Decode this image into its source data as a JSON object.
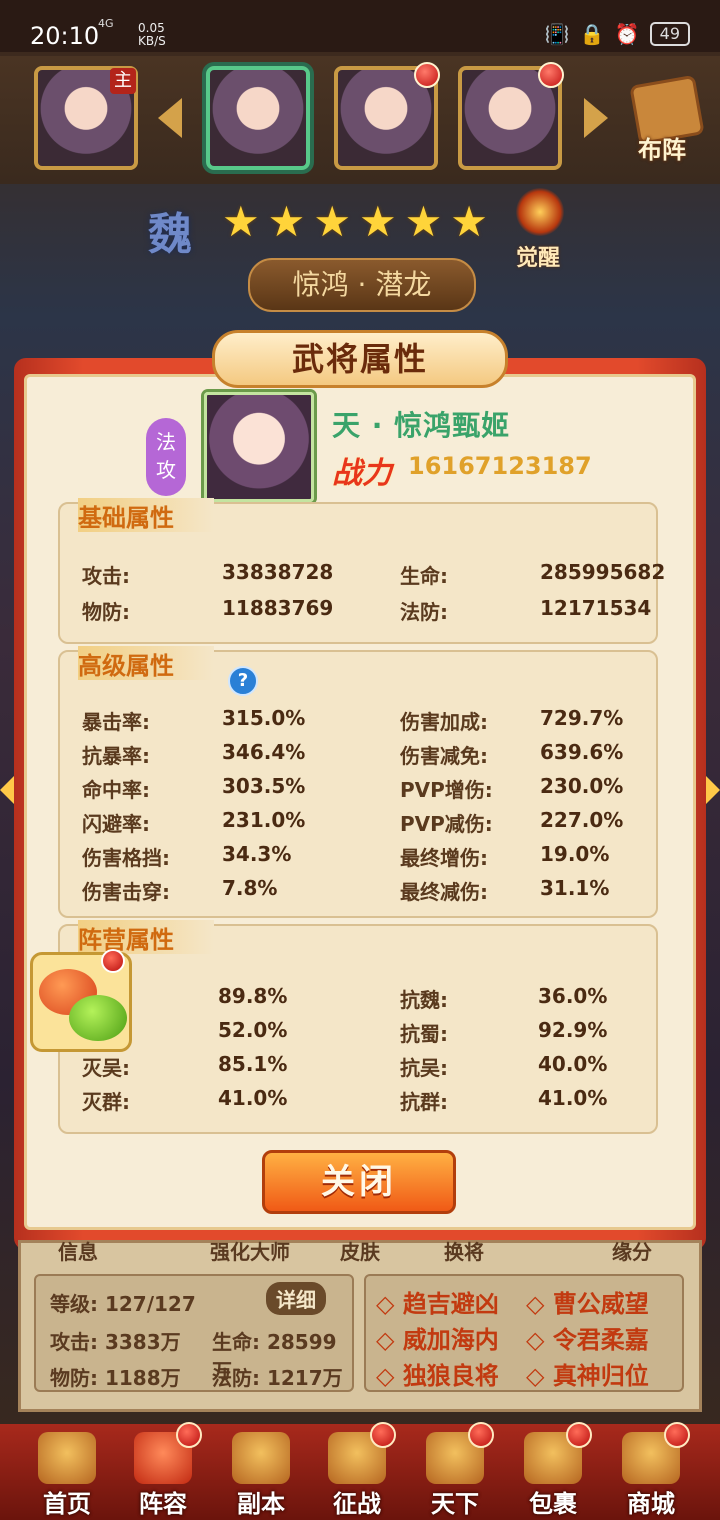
{
  "status_bar": {
    "time": "20:10",
    "network": "4G",
    "speed_value": "0.05",
    "speed_unit": "KB/S",
    "battery": "49"
  },
  "heroes_strip": {
    "main_tag": "主",
    "formation_label": "布阵"
  },
  "hero_banner": {
    "faction": "魏",
    "stars": [
      "★",
      "★",
      "★",
      "★",
      "★",
      "★"
    ],
    "awaken_label": "觉醒",
    "title": "惊鸿 · 潜龙"
  },
  "dialog": {
    "title": "武将属性",
    "type_badge": [
      "法",
      "攻"
    ],
    "hero_name": "天 · 惊鸿甄姬",
    "power_label": "战力",
    "power_value": "16167123187",
    "basic": {
      "title": "基础属性",
      "rows": [
        {
          "l1": "攻击:",
          "v1": "33838728",
          "l2": "生命:",
          "v2": "285995682"
        },
        {
          "l1": "物防:",
          "v1": "11883769",
          "l2": "法防:",
          "v2": "12171534"
        }
      ]
    },
    "advanced": {
      "title": "高级属性",
      "help": "?",
      "rows": [
        {
          "l1": "暴击率:",
          "v1": "315.0%",
          "l2": "伤害加成:",
          "v2": "729.7%"
        },
        {
          "l1": "抗暴率:",
          "v1": "346.4%",
          "l2": "伤害减免:",
          "v2": "639.6%"
        },
        {
          "l1": "命中率:",
          "v1": "303.5%",
          "l2": "PVP增伤:",
          "v2": "230.0%"
        },
        {
          "l1": "闪避率:",
          "v1": "231.0%",
          "l2": "PVP减伤:",
          "v2": "227.0%"
        },
        {
          "l1": "伤害格挡:",
          "v1": "34.3%",
          "l2": "最终增伤:",
          "v2": "19.0%"
        },
        {
          "l1": "伤害击穿:",
          "v1": "7.8%",
          "l2": "最终减伤:",
          "v2": "31.1%"
        }
      ]
    },
    "faction_attrs": {
      "title": "阵营属性",
      "rows": [
        {
          "l1": "",
          "v1": "89.8%",
          "l2": "抗魏:",
          "v2": "36.0%"
        },
        {
          "l1": "",
          "v1": "52.0%",
          "l2": "抗蜀:",
          "v2": "92.9%"
        },
        {
          "l1": "灭吴:",
          "v1": "85.1%",
          "l2": "抗吴:",
          "v2": "40.0%"
        },
        {
          "l1": "灭群:",
          "v1": "41.0%",
          "l2": "抗群:",
          "v2": "41.0%"
        }
      ]
    },
    "close_label": "关闭"
  },
  "lower_panel": {
    "tabs": [
      "信息",
      "强化大师",
      "皮肤",
      "换将",
      "缘分"
    ],
    "level": "等级: 127/127",
    "detail_btn": "详细",
    "attack": "攻击: 3383万",
    "hp": "生命: 28599万",
    "pdef": "物防: 1188万",
    "mdef": "法防: 1217万",
    "fates": [
      "◇ 趋吉避凶",
      "◇ 曹公威望",
      "◇ 威加海内",
      "◇ 令君柔嘉",
      "◇ 独狼良将",
      "◇ 真神归位"
    ]
  },
  "bottom_nav": {
    "items": [
      {
        "label": "首页"
      },
      {
        "label": "阵容"
      },
      {
        "label": "副本"
      },
      {
        "label": "征战"
      },
      {
        "label": "天下"
      },
      {
        "label": "包裹"
      },
      {
        "label": "商城"
      }
    ]
  },
  "colors": {
    "accent_red": "#e24a2c",
    "panel_bg": "#f7edd7",
    "section_title": "#d06a10"
  }
}
